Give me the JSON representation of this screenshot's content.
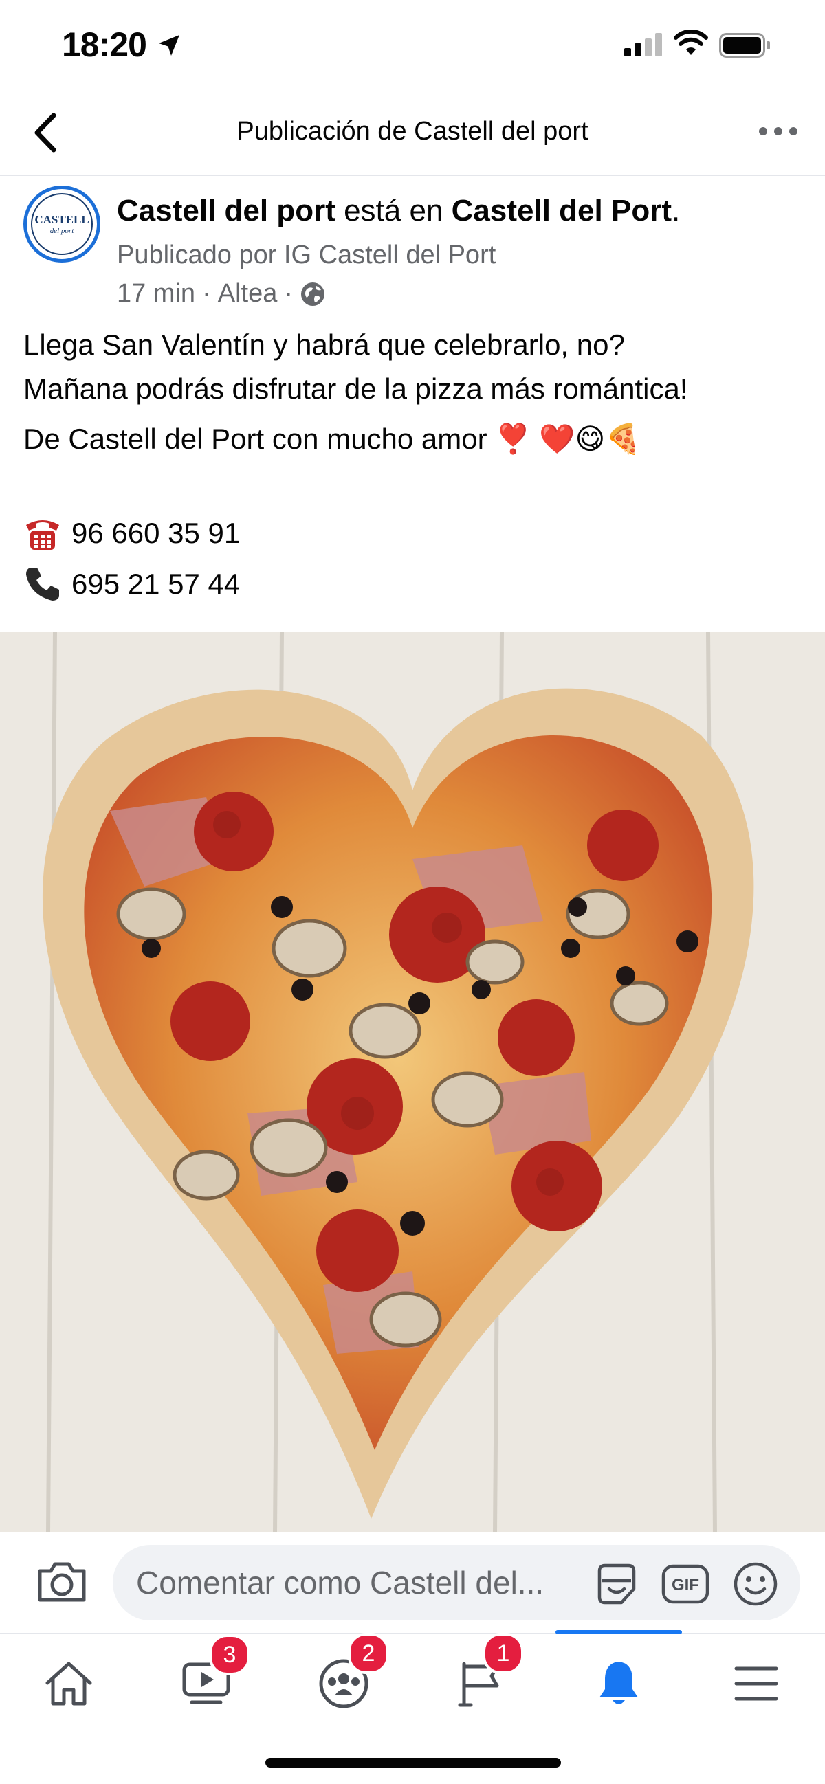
{
  "status_bar": {
    "time": "18:20"
  },
  "nav": {
    "title": "Publicación de Castell del port"
  },
  "avatar": {
    "logo_text": "CASTELL",
    "logo_sub": "del port"
  },
  "post": {
    "page_name": "Castell del port",
    "is_in": "está en",
    "location_name": "Castell del Port",
    "period": ".",
    "published_by": "Publicado por IG Castell del Port",
    "time_ago": "17 min",
    "separator1": "·",
    "place": "Altea",
    "separator2": "·",
    "text_line1": "Llega San Valentín y habrá que celebrarlo, no?",
    "text_line2": "Mañana podrás disfrutar de la pizza más romántica!",
    "text_line3": "De Castell del Port con mucho amor",
    "text_line3_emojis": "❣️ ❤️😋🍕",
    "phone1": "96 660 35 91",
    "phone2": "695 21 57 44",
    "photo_subject": "heart-shaped pizza"
  },
  "comment": {
    "placeholder": "Comentar como Castell del..."
  },
  "tabs": [
    {
      "name": "home",
      "badge": ""
    },
    {
      "name": "watch",
      "badge": "3"
    },
    {
      "name": "groups",
      "badge": "2"
    },
    {
      "name": "pages",
      "badge": "1"
    },
    {
      "name": "notifications",
      "badge": "",
      "active": true
    },
    {
      "name": "menu",
      "badge": ""
    }
  ],
  "colors": {
    "accent": "#1877f2",
    "badge": "#e41e3f",
    "secondary_text": "#65676b"
  }
}
